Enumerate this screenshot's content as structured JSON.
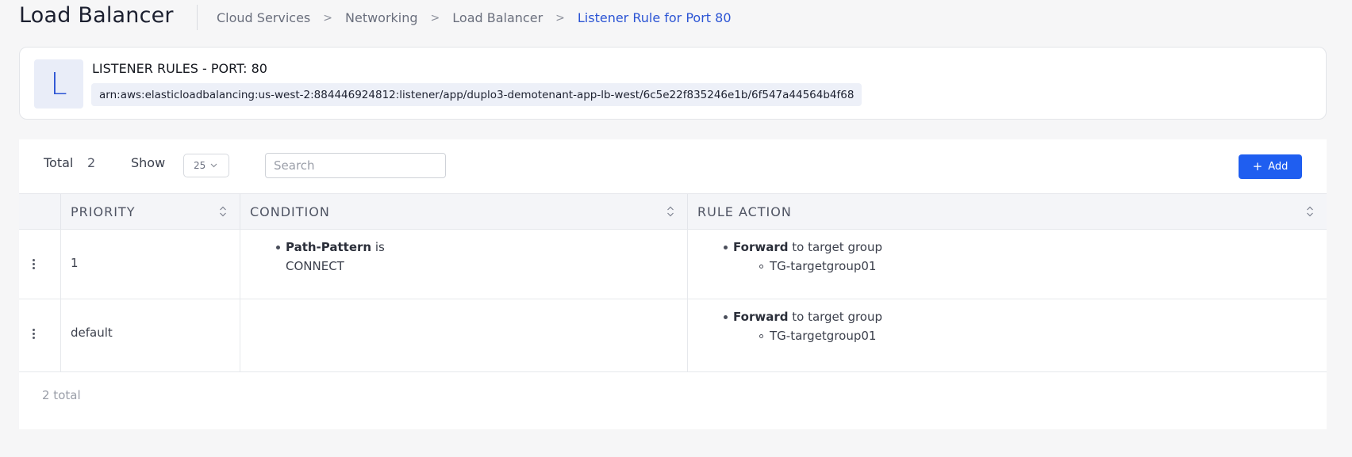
{
  "header": {
    "title": "Load Balancer",
    "breadcrumb": [
      {
        "label": "Cloud Services"
      },
      {
        "label": "Networking"
      },
      {
        "label": "Load Balancer"
      },
      {
        "label": "Listener Rule for Port 80"
      }
    ],
    "separator": ">"
  },
  "info_card": {
    "avatar_letter": "L",
    "title": "LISTENER RULES - PORT: 80",
    "arn": "arn:aws:elasticloadbalancing:us-west-2:884446924812:listener/app/duplo3-demotenant-app-lb-west/6c5e22f835246e1b/6f547a44564b4f68"
  },
  "toolbar": {
    "total_label": "Total",
    "total_value": "2",
    "show_label": "Show",
    "page_size": "25",
    "search_placeholder": "Search",
    "add_label": "Add"
  },
  "table": {
    "columns": [
      {
        "label": "PRIORITY"
      },
      {
        "label": "CONDITION"
      },
      {
        "label": "RULE ACTION"
      }
    ],
    "rows": [
      {
        "priority": "1",
        "condition_key": "Path-Pattern",
        "condition_op": " is",
        "condition_value": "CONNECT",
        "action_key": "Forward",
        "action_text": " to target group",
        "action_target": "TG-targetgroup01"
      },
      {
        "priority": "default",
        "action_key": "Forward",
        "action_text": " to target group",
        "action_target": "TG-targetgroup01"
      }
    ],
    "footer_total": "2 total"
  },
  "colors": {
    "accent": "#1f5ef0",
    "breadcrumb_current": "#2b54d4",
    "background": "#f6f6f7"
  }
}
